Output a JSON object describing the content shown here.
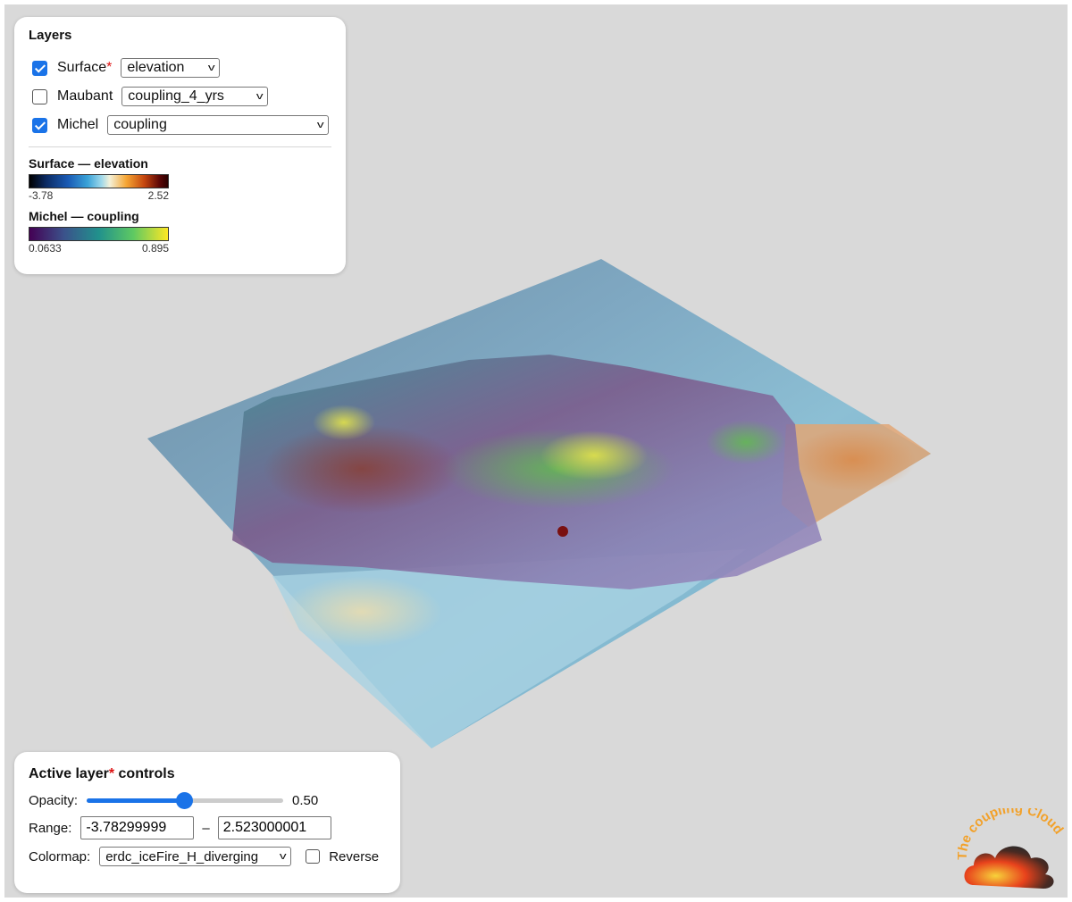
{
  "layers_panel": {
    "title": "Layers",
    "layers": [
      {
        "name": "Surface",
        "active_marker": "*",
        "checked": true,
        "selected": "elevation"
      },
      {
        "name": "Maubant",
        "active_marker": "",
        "checked": false,
        "selected": "coupling_4_yrs"
      },
      {
        "name": "Michel",
        "active_marker": "",
        "checked": true,
        "selected": "coupling"
      }
    ],
    "legends": [
      {
        "title": "Surface — elevation",
        "min": "-3.78",
        "max": "2.52",
        "colormap": "elevation"
      },
      {
        "title": "Michel — coupling",
        "min": "0.0633",
        "max": "0.895",
        "colormap": "viridis"
      }
    ]
  },
  "controls_panel": {
    "title_prefix": "Active layer",
    "title_marker": "*",
    "title_suffix": " controls",
    "opacity_label": "Opacity:",
    "opacity_value": "0.50",
    "opacity_fraction": 0.5,
    "range_label": "Range:",
    "range_min": "-3.78299999",
    "range_max": "2.523000001",
    "range_separator": "–",
    "colormap_label": "Colormap:",
    "colormap_value": "erdc_iceFire_H_diverging",
    "reverse_label": "Reverse",
    "reverse_checked": false
  },
  "logo": {
    "text": "The coupling Cloud",
    "colors": {
      "text": "#f2a12a",
      "cloud_hot": "#f7d23a",
      "cloud_mid": "#e8421c",
      "cloud_dark": "#2b2b2b"
    }
  },
  "colors": {
    "background": "#d9d9d9",
    "accent": "#1a73e8",
    "active_marker": "#d11111"
  }
}
